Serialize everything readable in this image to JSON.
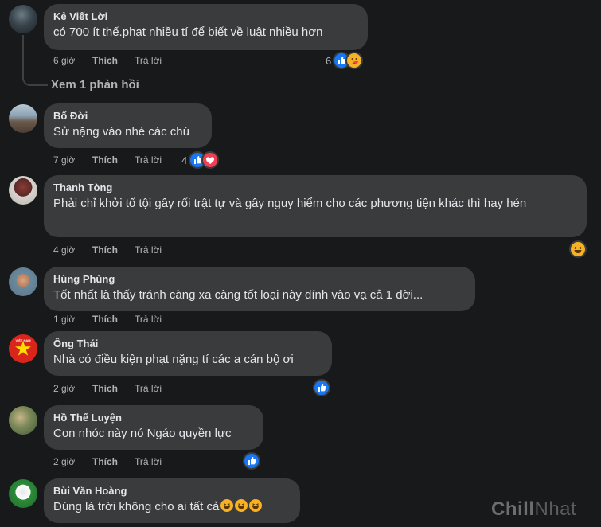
{
  "comments": [
    {
      "author": "Kẻ Viết Lời",
      "text": "có 700 ít thế.phạt nhiều tí để biết về luật nhiều hơn",
      "time": "6 giờ",
      "like": "Thích",
      "reply": "Trả lời",
      "reaction_count": "6"
    },
    {
      "author": "Bố Đời",
      "text": "Sử nặng vào nhé các chú",
      "time": "7 giờ",
      "like": "Thích",
      "reply": "Trả lời",
      "reaction_count": "4"
    },
    {
      "author": "Thanh Tòng",
      "text": "Phải chỉ khởi tố tội gây rối trật tự và gây nguy hiểm cho các phương tiện khác thì hay hén",
      "time": "4 giờ",
      "like": "Thích",
      "reply": "Trả lời"
    },
    {
      "author": "Hùng Phùng",
      "text": "Tốt nhất là thấy tránh càng xa càng tốt loại này dính vào vạ cả 1 đời...",
      "time": "1 giờ",
      "like": "Thích",
      "reply": "Trả lời"
    },
    {
      "author": "Ông Thái",
      "text": "Nhà có điều kiện phạt nặng tí các a cán bộ ơi",
      "time": "2 giờ",
      "like": "Thích",
      "reply": "Trả lời"
    },
    {
      "author": "Hồ Thế Luyện",
      "text": "Con nhóc này nó Ngáo quyền lực",
      "time": "2 giờ",
      "like": "Thích",
      "reply": "Trả lời"
    },
    {
      "author": "Bùi Văn Hoàng",
      "text": "Đúng là trời không cho ai tất cả"
    }
  ],
  "view_replies": "Xem 1 phản hồi",
  "avatar_flag_text": "VIỆT NAM",
  "watermark": {
    "part1": "Chill",
    "part2": "Nhat"
  },
  "colors": {
    "background": "#18191a",
    "bubble": "#3a3b3c",
    "like": "#1877f2",
    "heart": "#f33e58",
    "haha": "#f7b125"
  },
  "icons": [
    "like-reaction-icon",
    "care-reaction-icon",
    "heart-reaction-icon",
    "haha-reaction-icon",
    "laughing-emoji-icon"
  ]
}
